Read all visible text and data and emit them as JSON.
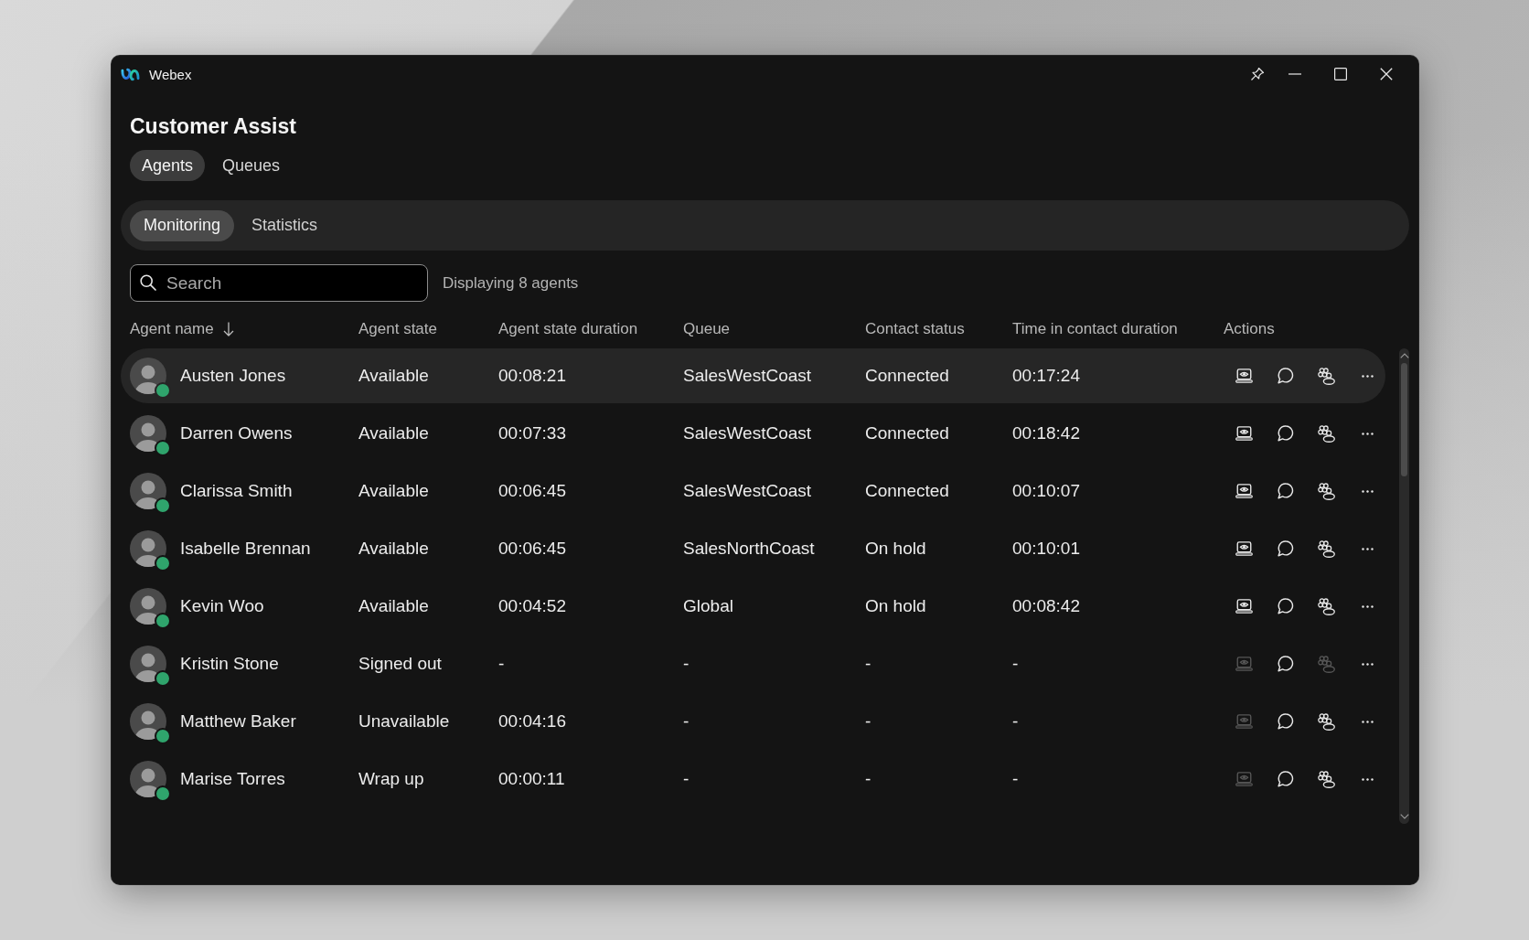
{
  "window": {
    "title": "Webex"
  },
  "page": {
    "title": "Customer Assist"
  },
  "tabs": [
    {
      "label": "Agents",
      "selected": true
    },
    {
      "label": "Queues",
      "selected": false
    }
  ],
  "subtabs": [
    {
      "label": "Monitoring",
      "selected": true
    },
    {
      "label": "Statistics",
      "selected": false
    }
  ],
  "search": {
    "placeholder": "Search"
  },
  "result_count": "Displaying 8 agents",
  "table": {
    "columns": [
      {
        "label": "Agent name",
        "sorted": true
      },
      {
        "label": "Agent state",
        "sorted": false
      },
      {
        "label": "Agent state duration",
        "sorted": false
      },
      {
        "label": "Queue",
        "sorted": false
      },
      {
        "label": "Contact status",
        "sorted": false
      },
      {
        "label": "Time in contact duration",
        "sorted": false
      },
      {
        "label": "Actions",
        "sorted": false
      }
    ],
    "rows": [
      {
        "selected": true,
        "color": "#2fa46c",
        "cells": [
          "Austen Jones",
          "Available",
          "00:08:21",
          "SalesWestCoast",
          "Connected",
          "00:17:24"
        ],
        "actions": [
          {
            "kind": "monitor",
            "disabled": false
          },
          {
            "kind": "chat",
            "disabled": false
          },
          {
            "kind": "people",
            "disabled": false
          },
          {
            "kind": "more",
            "disabled": false
          }
        ]
      },
      {
        "selected": false,
        "color": "#2fa46c",
        "cells": [
          "Darren Owens",
          "Available",
          "00:07:33",
          "SalesWestCoast",
          "Connected",
          "00:18:42"
        ],
        "actions": [
          {
            "kind": "monitor",
            "disabled": false
          },
          {
            "kind": "chat",
            "disabled": false
          },
          {
            "kind": "people",
            "disabled": false
          },
          {
            "kind": "more",
            "disabled": false
          }
        ]
      },
      {
        "selected": false,
        "color": "#2fa46c",
        "cells": [
          "Clarissa Smith",
          "Available",
          "00:06:45",
          "SalesWestCoast",
          "Connected",
          "00:10:07"
        ],
        "actions": [
          {
            "kind": "monitor",
            "disabled": false
          },
          {
            "kind": "chat",
            "disabled": false
          },
          {
            "kind": "people",
            "disabled": false
          },
          {
            "kind": "more",
            "disabled": false
          }
        ]
      },
      {
        "selected": false,
        "color": "#2fa46c",
        "cells": [
          "Isabelle Brennan",
          "Available",
          "00:06:45",
          "SalesNorthCoast",
          "On hold",
          "00:10:01"
        ],
        "actions": [
          {
            "kind": "monitor",
            "disabled": false
          },
          {
            "kind": "chat",
            "disabled": false
          },
          {
            "kind": "people",
            "disabled": false
          },
          {
            "kind": "more",
            "disabled": false
          }
        ]
      },
      {
        "selected": false,
        "color": "#2fa46c",
        "cells": [
          "Kevin Woo",
          "Available",
          "00:04:52",
          "Global",
          "On hold",
          "00:08:42"
        ],
        "actions": [
          {
            "kind": "monitor",
            "disabled": false
          },
          {
            "kind": "chat",
            "disabled": false
          },
          {
            "kind": "people",
            "disabled": false
          },
          {
            "kind": "more",
            "disabled": false
          }
        ]
      },
      {
        "selected": false,
        "color": "#2fa46c",
        "cells": [
          "Kristin Stone",
          "Signed out",
          "-",
          "-",
          "-",
          "-"
        ],
        "actions": [
          {
            "kind": "monitor",
            "disabled": true
          },
          {
            "kind": "chat",
            "disabled": false
          },
          {
            "kind": "people",
            "disabled": true
          },
          {
            "kind": "more",
            "disabled": false
          }
        ]
      },
      {
        "selected": false,
        "color": "#2fa46c",
        "cells": [
          "Matthew Baker",
          "Unavailable",
          "00:04:16",
          "-",
          "-",
          "-"
        ],
        "actions": [
          {
            "kind": "monitor",
            "disabled": true
          },
          {
            "kind": "chat",
            "disabled": false
          },
          {
            "kind": "people",
            "disabled": false
          },
          {
            "kind": "more",
            "disabled": false
          }
        ]
      },
      {
        "selected": false,
        "color": "#2fa46c",
        "cells": [
          "Marise Torres",
          "Wrap up",
          "00:00:11",
          "-",
          "-",
          "-"
        ],
        "actions": [
          {
            "kind": "monitor",
            "disabled": true
          },
          {
            "kind": "chat",
            "disabled": false
          },
          {
            "kind": "people",
            "disabled": false
          },
          {
            "kind": "more",
            "disabled": false
          }
        ]
      }
    ]
  }
}
